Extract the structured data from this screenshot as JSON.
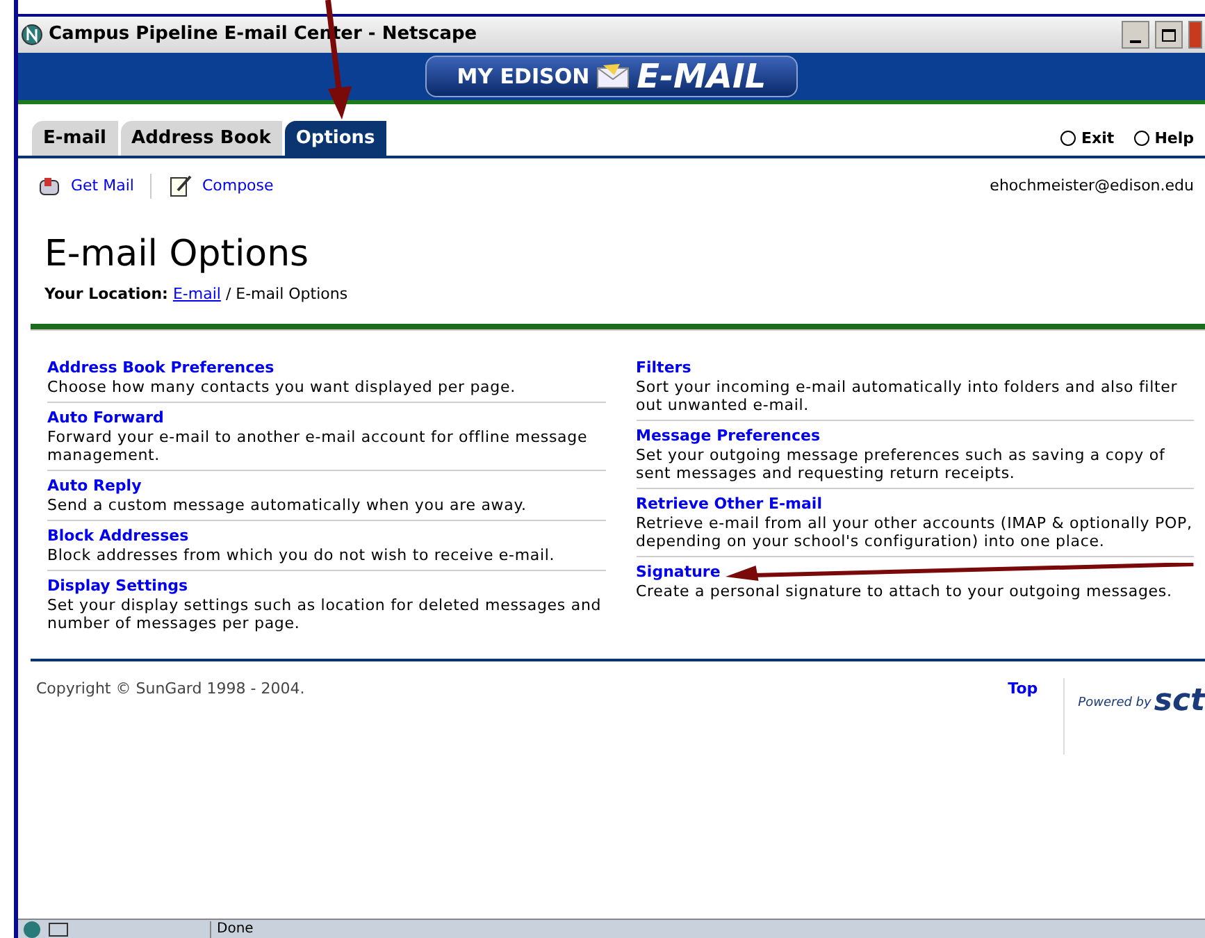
{
  "window": {
    "title": "Campus Pipeline E-mail Center - Netscape"
  },
  "banner": {
    "left": "MY EDISON",
    "right": "E-MAIL"
  },
  "tabs": [
    {
      "label": "E-mail",
      "selected": false
    },
    {
      "label": "Address Book",
      "selected": false
    },
    {
      "label": "Options",
      "selected": true
    }
  ],
  "top_links": [
    "Exit",
    "Help"
  ],
  "toolbar": {
    "items": [
      "Get Mail",
      "Compose"
    ],
    "user": "ehochmeister@edison.edu"
  },
  "page": {
    "title": "E-mail Options",
    "location_label": "Your Location:",
    "location_link": "E-mail",
    "location_current": "/ E-mail Options"
  },
  "options_left": [
    {
      "title": "Address Book Preferences",
      "description": "Choose how many contacts you want displayed per page."
    },
    {
      "title": "Auto Forward",
      "description": "Forward your e-mail to another e-mail account for offline message management."
    },
    {
      "title": "Auto Reply",
      "description": "Send a custom message automatically when you are away."
    },
    {
      "title": "Block Addresses",
      "description": "Block addresses from which you do not wish to receive e-mail."
    },
    {
      "title": "Display Settings",
      "description": "Set your display settings such as location for deleted messages and number of messages per page."
    }
  ],
  "options_right": [
    {
      "title": "Filters",
      "description": "Sort your incoming e-mail automatically into folders and also filter out unwanted e-mail."
    },
    {
      "title": "Message Preferences",
      "description": "Set your outgoing message preferences such as saving a copy of sent messages and requesting return receipts."
    },
    {
      "title": "Retrieve Other E-mail",
      "description": "Retrieve e-mail from all your other accounts (IMAP & optionally POP, depending on your school's configuration) into one place."
    },
    {
      "title": "Signature",
      "description": "Create a personal signature to attach to your outgoing messages.",
      "annotated": true
    }
  ],
  "footer": {
    "copyright": "Copyright © SunGard 1998 - 2004.",
    "top_link": "Top",
    "powered_by": "Powered by",
    "logo": "sct"
  },
  "status_bar": {
    "text": "Done"
  }
}
